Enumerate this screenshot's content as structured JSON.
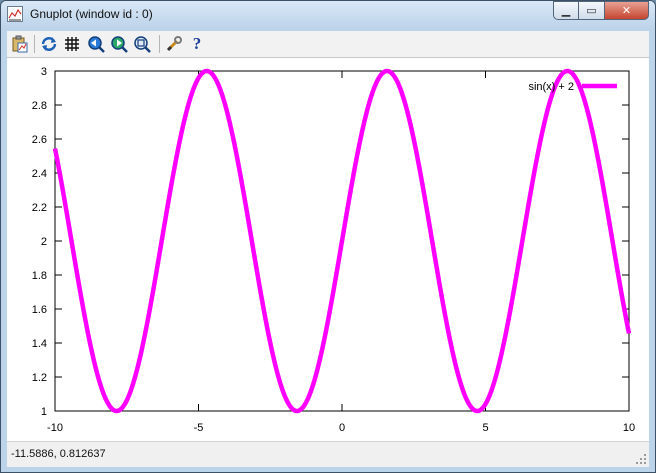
{
  "window": {
    "title": "Gnuplot (window id : 0)"
  },
  "window_buttons": {
    "minimize": "▁",
    "maximize": "▭",
    "close": "✕"
  },
  "toolbar": {
    "items": [
      {
        "icon": "copy-to-clipboard-icon"
      },
      {
        "icon": "replot-icon"
      },
      {
        "icon": "grid-icon"
      },
      {
        "icon": "zoom-back-icon"
      },
      {
        "icon": "zoom-forward-icon"
      },
      {
        "icon": "autoscale-icon"
      },
      {
        "icon": "options-wrench-icon"
      },
      {
        "icon": "help-icon"
      }
    ],
    "help_glyph": "?"
  },
  "status": {
    "coordinates": "-11.5886,  0.812637"
  },
  "colors": {
    "series": "#ff00ff"
  },
  "chart_data": {
    "type": "line",
    "title": "",
    "xlabel": "",
    "ylabel": "",
    "xlim": [
      -10,
      10
    ],
    "ylim": [
      1,
      3
    ],
    "x_ticks": [
      -10,
      -5,
      0,
      5,
      10
    ],
    "x_tick_labels": [
      "-10",
      "-5",
      "0",
      "5",
      "10"
    ],
    "y_ticks": [
      1,
      1.2,
      1.4,
      1.6,
      1.8,
      2,
      2.2,
      2.4,
      2.6,
      2.8,
      3
    ],
    "y_tick_labels": [
      "1",
      "1.2",
      "1.4",
      "1.6",
      "1.8",
      "2",
      "2.2",
      "2.4",
      "2.6",
      "2.8",
      "3"
    ],
    "grid": false,
    "legend_position": "top-right",
    "series": [
      {
        "name": "sin(x) + 2",
        "function": "sin(x) + 2",
        "color": "#ff00ff"
      }
    ]
  }
}
